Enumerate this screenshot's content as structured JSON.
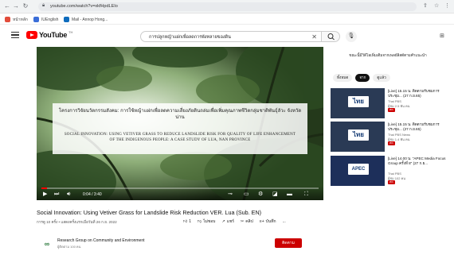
{
  "browser": {
    "url": "youtube.com/watch?v=xkfHpdLEIo",
    "bookmarks": [
      {
        "label": "หน้าหลัก",
        "color": "#e24c3b"
      },
      {
        "label": "IUEnglish",
        "color": "#3b6ed8"
      },
      {
        "label": "Mail - Annop Hong...",
        "color": "#0f6cbd"
      }
    ]
  },
  "header": {
    "logo_text": "YouTube",
    "logo_region": "TH",
    "search_value": "การปลูกหญ้าแฝกเพื่อลดการพังทลายของดิน"
  },
  "player": {
    "title_th": "โครงการวิจัยนวัตกรรมสังคม: การใช้หญ้าแฝกเพื่อลดความเสี่ยงภัยดินถล่มเพื่อเพิ่มคุณภาพชีวิตกลุ่มชาติพันธุ์ลัวะ จังหวัดน่าน",
    "title_en_line1": "SOCIAL INNOVATION: USING VETIVER GRASS TO REDUCE LANDSLIDE RISK FOR QUALITY OF LIFE ENHANCEMENT",
    "title_en_line2": "OF THE INDIGENOUS PEOPLE: A CASE STUDY OF LUA, NAN PROVINCE",
    "time": "0:04 / 3:40",
    "progress_fraction": 0.02
  },
  "video": {
    "title": "Social Innovation: Using Vetiver Grass for Landslide Risk Reduction VER. Lua (Sub. EN)",
    "meta": "การดู 10 ครั้ง • แสดงครั้งแรกเมื่อวันที่ 26 ก.ย. 2022",
    "actions": {
      "like_count": "1",
      "dislike": "ไม่ชอบ",
      "share": "แชร์",
      "clip": "คลิป",
      "save": "บันทึก",
      "more": "..."
    },
    "channel": {
      "name": "Research Group on Community and Environment",
      "subs": "ผู้ติดตาม 100 คน",
      "subscribe": "ติดตาม"
    }
  },
  "sidebar": {
    "notice": "ขณะนี้มีวิดีโอเพิ่มเติมจากเพลย์ลิสต์ตามคำแนะนำ",
    "chips": [
      "ทั้งหมด",
      "จาก",
      "ดูแล้ว"
    ],
    "recommendations": [
      {
        "title": "[Live] 15.15 น. ติดตามรับชมการประชุม... (27 ก.ย.65)",
        "channel": "Thai PBS",
        "views": "ผู้ชม 2.5 พัน คน",
        "badge": "สด",
        "thumb_text": "ไทย"
      },
      {
        "title": "[Live] 15.15 น. ติดตามรับชมการประชุม... (27 ก.ย.65)",
        "channel": "Thai PBS News",
        "views": "ผู้ชม 1.4 พัน คน",
        "badge": "สด",
        "thumb_text": "ไทย"
      },
      {
        "title": "[Live] 14.00 น. \"APEC Media Focus Group ครั้งที่ 8\" (27 ก.ย...",
        "channel": "Thai PBS",
        "views": "ผู้ชม 102 คน",
        "badge": "สด",
        "thumb_text": "APEC"
      }
    ]
  }
}
